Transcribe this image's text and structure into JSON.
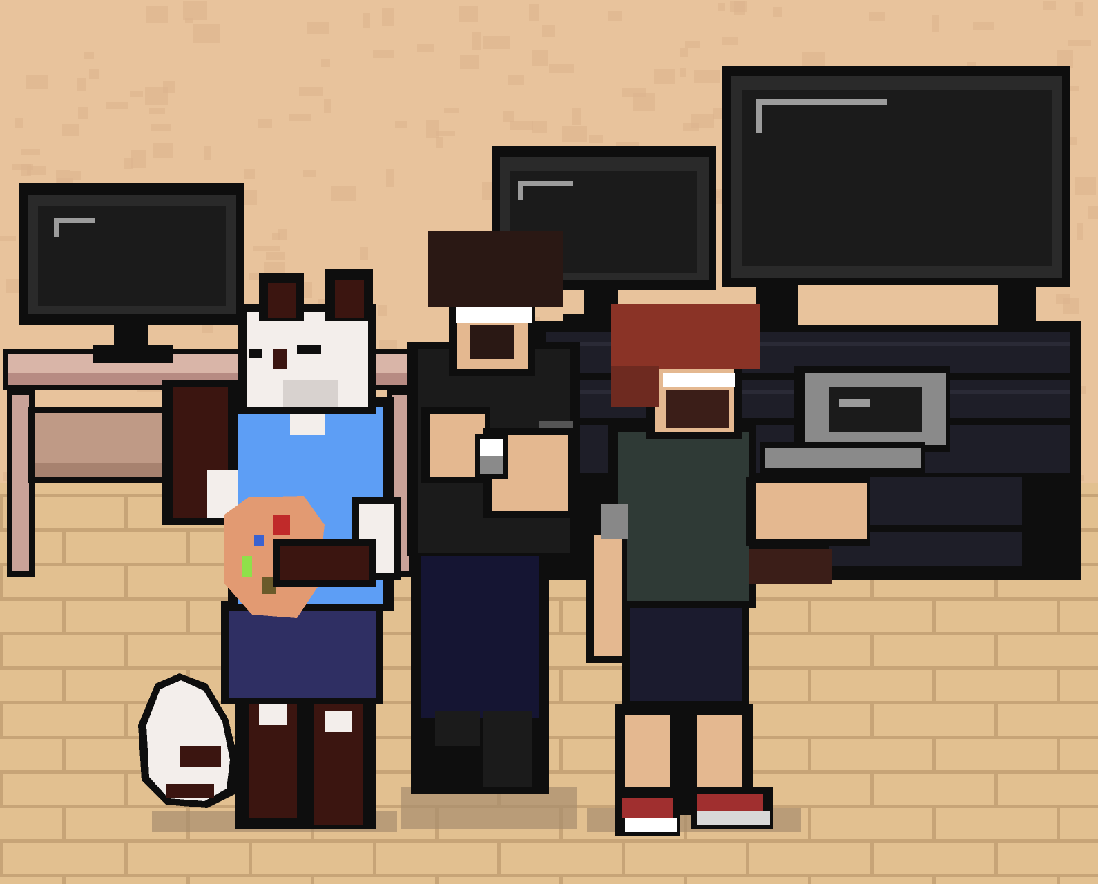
{
  "scene": {
    "setting": "office",
    "colors": {
      "wall": "#e8c39c",
      "wall_noise": "#dcb48d",
      "floor": "#e2c090",
      "floor_line": "#c7a477",
      "floor_shadow": "#a88d6d",
      "desk_top": "#d9b5a8",
      "desk_leg": "#c9a298",
      "outline": "#0e0e0e",
      "screen": "#1b1b1b",
      "screen_glare": "#9c9c9c",
      "cabinet": "#1a1a24"
    }
  },
  "objects": {
    "monitors": [
      {
        "name": "monitor-left",
        "icon": "monitor-icon"
      },
      {
        "name": "monitor-center",
        "icon": "monitor-icon"
      },
      {
        "name": "monitor-right",
        "icon": "monitor-icon"
      }
    ],
    "furniture": [
      "desk",
      "cabinet"
    ],
    "props": [
      "laptop",
      "coffee-cup",
      "paint-palette"
    ]
  },
  "characters": [
    {
      "name": "cat-artist",
      "type": "white cat",
      "shirt": "#5d9ef5",
      "skirt": "#2f2f63",
      "fur": "#f3eeeb",
      "fur_dark": "#3b1510",
      "holds": "paint-palette"
    },
    {
      "name": "dark-haired-man",
      "type": "human",
      "hair": "#2a1814",
      "shirt": "#1b1b1b",
      "pants": "#151533",
      "skin": "#e4b890",
      "holds": "coffee-cup"
    },
    {
      "name": "red-haired-man",
      "type": "human",
      "hair": "#8a3326",
      "shirt": "#2f3a36",
      "shorts": "#1b1b2e",
      "skin": "#e4b890",
      "shoes": "#a02f2f",
      "holds": "laptop"
    }
  ]
}
